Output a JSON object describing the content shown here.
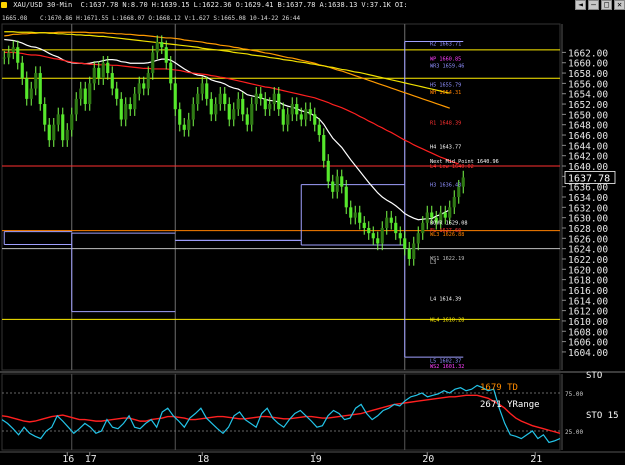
{
  "header": {
    "symbol_info": "XAU/USD 30-Min",
    "stats": [
      "C:1637.78",
      "N:8.70",
      "H:1639.15",
      "L:1622.36",
      "O:1629.41",
      "B:1637.78",
      "A:1638.13",
      "V:37.1K",
      "OI:"
    ],
    "row2": "1665.08",
    "row3": "C:1670.86 H:1671.55 L:1668.07 O:1668.12 V:1.627 S:1665.08 10-14-22 26:44",
    "window_buttons": [
      "◄",
      "—",
      "□",
      "✕"
    ]
  },
  "chart_data": {
    "type": "line",
    "title": "XAU/USD 30-Min",
    "ylim": [
      1600.5,
      1667.5
    ],
    "price_ticks": [
      1604,
      1606,
      1608,
      1610,
      1612,
      1614,
      1616,
      1618,
      1620,
      1622,
      1624,
      1626,
      1628,
      1630,
      1632,
      1634,
      1636,
      1638,
      1640,
      1642,
      1644,
      1646,
      1648,
      1650,
      1652,
      1654,
      1656,
      1658,
      1660,
      1662
    ],
    "last_price": "1637.78",
    "last_price_value": 1637.78,
    "x_labels": [
      {
        "label": "16",
        "bar": 14
      },
      {
        "label": "17",
        "bar": 19
      },
      {
        "label": "18",
        "bar": 44
      },
      {
        "label": "19",
        "bar": 69
      },
      {
        "label": "20",
        "bar": 94
      },
      {
        "label": "21",
        "bar": 118
      }
    ],
    "bar_count": 124,
    "day_separators": [
      15,
      38,
      89
    ],
    "candles": [
      1661,
      1662,
      1663,
      1660,
      1657,
      1653,
      1655,
      1658,
      1652,
      1648,
      1645,
      1648,
      1650,
      1645,
      1647,
      1650,
      1653,
      1655,
      1652,
      1656,
      1659,
      1657,
      1660,
      1658,
      1655,
      1653,
      1649,
      1652,
      1651,
      1654,
      1656,
      1655,
      1658,
      1662,
      1664,
      1663,
      1660,
      1656,
      1651,
      1648,
      1647,
      1649,
      1652,
      1654,
      1656,
      1653,
      1650,
      1652,
      1654,
      1652,
      1649,
      1651,
      1653,
      1650,
      1648,
      1652,
      1654,
      1653,
      1651,
      1652,
      1654,
      1651,
      1648,
      1650,
      1652,
      1650,
      1649,
      1651,
      1650,
      1648,
      1646,
      1641,
      1637,
      1635,
      1638,
      1636,
      1632,
      1630,
      1631,
      1629,
      1628,
      1627,
      1626,
      1625,
      1628,
      1630,
      1629,
      1627,
      1626,
      1624,
      1622,
      1625,
      1627,
      1629,
      1631,
      1630,
      1629,
      1631,
      1630,
      1632,
      1634,
      1636,
      1637.78
    ],
    "series": [
      {
        "values": [
          1664.5,
          1664.4,
          1664.3,
          1664.1,
          1663.8,
          1663.4,
          1663.1,
          1663,
          1662.7,
          1662.3,
          1661.8,
          1661.4,
          1661.1,
          1660.6,
          1660.2,
          1660,
          1659.9,
          1659.9,
          1659.8,
          1659.9,
          1660.1,
          1660.2,
          1660.4,
          1660.6,
          1660.6,
          1660.5,
          1660.2,
          1660.1,
          1659.9,
          1659.9,
          1659.9,
          1659.9,
          1660,
          1660.2,
          1660.5,
          1660.7,
          1660.7,
          1660.5,
          1660,
          1659.4,
          1658.8,
          1658.3,
          1657.9,
          1657.6,
          1657.5,
          1657.2,
          1656.7,
          1656.4,
          1656.2,
          1655.9,
          1655.4,
          1655.1,
          1654.9,
          1654.4,
          1653.8,
          1653.6,
          1653.4,
          1653.2,
          1652.9,
          1652.7,
          1652.6,
          1652.4,
          1651.9,
          1651.6,
          1651.4,
          1651.1,
          1650.7,
          1650.5,
          1650.2,
          1649.7,
          1649.1,
          1648.1,
          1646.7,
          1645.4,
          1644.5,
          1643.6,
          1642.4,
          1641.2,
          1640.1,
          1639,
          1637.9,
          1636.8,
          1635.8,
          1634.8,
          1634,
          1633.4,
          1632.9,
          1632.3,
          1631.6,
          1630.8,
          1630.3,
          1629.9,
          1629.6,
          1629.7,
          1629.8,
          1629.8,
          1630.3,
          1630.6,
          1631.1,
          1631.5
        ]
      },
      {
        "values": [
          1662,
          1662,
          1662,
          1661.9,
          1661.8,
          1661.6,
          1661.5,
          1661.5,
          1661.4,
          1661.2,
          1661,
          1660.8,
          1660.7,
          1660.5,
          1660.3,
          1660.1,
          1660,
          1659.9,
          1659.8,
          1659.7,
          1659.7,
          1659.6,
          1659.6,
          1659.6,
          1659.5,
          1659.5,
          1659.4,
          1659.3,
          1659.2,
          1659.1,
          1659,
          1658.9,
          1658.9,
          1658.8,
          1658.8,
          1658.8,
          1658.8,
          1658.7,
          1658.6,
          1658.5,
          1658.3,
          1658.1,
          1658,
          1657.9,
          1657.8,
          1657.7,
          1657.5,
          1657.4,
          1657.2,
          1657.1,
          1656.9,
          1656.7,
          1656.5,
          1656.3,
          1656.1,
          1655.9,
          1655.7,
          1655.5,
          1655.3,
          1655.2,
          1655,
          1654.8,
          1654.6,
          1654.4,
          1654.2,
          1654,
          1653.8,
          1653.6,
          1653.4,
          1653.2,
          1652.9,
          1652.6,
          1652.3,
          1651.9,
          1651.6,
          1651.3,
          1650.9,
          1650.5,
          1650.1,
          1649.6,
          1649.2,
          1648.7,
          1648.3,
          1647.8,
          1647.4,
          1646.9,
          1646.5,
          1646,
          1645.5,
          1645,
          1644.6,
          1644.1,
          1643.7,
          1643.3,
          1642.9,
          1642.5,
          1642.1,
          1641.7,
          1641.4,
          1641,
          1640.7,
          1640.4
        ]
      },
      {
        "values": [
          1665.2,
          1665.3,
          1665.5,
          1665.5,
          1665.6,
          1665.6,
          1665.7,
          1665.7,
          1665.8,
          1665.8,
          1665.8,
          1665.8,
          1665.9,
          1665.9,
          1665.9,
          1665.9,
          1665.9,
          1665.9,
          1665.9,
          1665.8,
          1665.8,
          1665.8,
          1665.8,
          1665.7,
          1665.7,
          1665.6,
          1665.6,
          1665.5,
          1665.5,
          1665.4,
          1665.3,
          1665.3,
          1665.2,
          1665.1,
          1665,
          1664.9,
          1664.8,
          1664.8,
          1664.7,
          1664.6,
          1664.4,
          1664.3,
          1664.2,
          1664.1,
          1664,
          1663.8,
          1663.7,
          1663.6,
          1663.4,
          1663.3,
          1663.2,
          1663,
          1662.9,
          1662.7,
          1662.6,
          1662.4,
          1662.3,
          1662.1,
          1661.9,
          1661.8,
          1661.6,
          1661.4,
          1661.2,
          1661,
          1660.9,
          1660.7,
          1660.5,
          1660.3,
          1660.1,
          1659.9,
          1659.6,
          1659.4,
          1659.2,
          1658.9,
          1658.6,
          1658.4,
          1658.1,
          1657.8,
          1657.5,
          1657.2,
          1656.9,
          1656.6,
          1656.3,
          1656,
          1655.7,
          1655.4,
          1655.1,
          1654.8,
          1654.5,
          1654.2,
          1653.9,
          1653.6,
          1653.3,
          1653,
          1652.7,
          1652.4,
          1652.1,
          1651.8,
          1651.5,
          1651.2
        ]
      },
      {
        "values": [
          1666,
          1666,
          1666,
          1665.9,
          1665.9,
          1665.9,
          1665.9,
          1665.8,
          1665.8,
          1665.8,
          1665.7,
          1665.7,
          1665.6,
          1665.6,
          1665.5,
          1665.5,
          1665.4,
          1665.4,
          1665.3,
          1665.3,
          1665.2,
          1665.1,
          1665.1,
          1665,
          1664.9,
          1664.8,
          1664.7,
          1664.6,
          1664.5,
          1664.4,
          1664.3,
          1664.2,
          1664.1,
          1664,
          1663.9,
          1663.8,
          1663.7,
          1663.6,
          1663.5,
          1663.4,
          1663.3,
          1663.2,
          1663.1,
          1663,
          1662.8,
          1662.7,
          1662.6,
          1662.5,
          1662.4,
          1662.3,
          1662.2,
          1662,
          1661.9,
          1661.8,
          1661.7,
          1661.5,
          1661.4,
          1661.3,
          1661.2,
          1661,
          1660.9,
          1660.8,
          1660.6,
          1660.5,
          1660.4,
          1660.2,
          1660.1,
          1660,
          1659.8,
          1659.7,
          1659.5,
          1659.4,
          1659.2,
          1659.1,
          1658.9,
          1658.7,
          1658.6,
          1658.4,
          1658.2,
          1658.1,
          1657.9,
          1657.7,
          1657.5,
          1657.3,
          1657.1,
          1656.9,
          1656.7,
          1656.5,
          1656.3,
          1656.1,
          1655.9,
          1655.7,
          1655.5,
          1655.3,
          1655.1,
          1654.9,
          1654.7,
          1654.5,
          1654.3,
          1654.1
        ]
      }
    ],
    "horizontal_lines": [
      {
        "label": "",
        "value": 1657.0,
        "color": "#ffee00"
      },
      {
        "label": "",
        "value": 1662.5,
        "color": "#ffee00"
      },
      {
        "label": "",
        "value": 1640.0,
        "color": "#ff3030"
      },
      {
        "label": "",
        "value": 1627.5,
        "color": "#ff8000"
      },
      {
        "label": "",
        "value": 1624.0,
        "color": "#c0c0c0"
      },
      {
        "label": "",
        "value": 1610.3,
        "color": "#ffee00"
      }
    ],
    "steps": [
      {
        "x0": 0,
        "x1": 15,
        "hi": 1627.3,
        "lo": 1624.8
      },
      {
        "x0": 15,
        "x1": 38,
        "hi": 1627.0,
        "lo": 1611.8
      },
      {
        "x0": 38,
        "x1": 66,
        "hi": 1625.6,
        "lo": 1625.6
      },
      {
        "x0": 66,
        "x1": 89,
        "hi": 1636.4,
        "lo": 1624.7
      },
      {
        "x0": 89,
        "x1": 102,
        "hi": 1664.1,
        "lo": 1603.0
      }
    ],
    "pivot_labels": [
      {
        "text": "R2 1663.71",
        "value": 1663.71,
        "color": "#9090ff"
      },
      {
        "text": "WP 1660.85",
        "value": 1660.85,
        "color": "#ff40ff"
      },
      {
        "text": "WR3 1659.46",
        "value": 1659.46,
        "color": "#9090ff"
      },
      {
        "text": "H5 1655.79",
        "value": 1655.79,
        "color": "#9090ff"
      },
      {
        "text": "WH 1654.31",
        "value": 1654.31,
        "color": "#ff8000"
      },
      {
        "text": "R1 1648.39",
        "value": 1648.39,
        "color": "#ff3030"
      },
      {
        "text": "H4 1643.77",
        "value": 1643.77,
        "color": "#ffffff"
      },
      {
        "text": "Next Mid Point 1640.96",
        "value": 1640.96,
        "color": "#ffffff"
      },
      {
        "text": "L4 Low 1640.02",
        "value": 1640.02,
        "color": "#ff3030"
      },
      {
        "text": "H3 1636.43",
        "value": 1636.43,
        "color": "#9090ff"
      },
      {
        "text": "BOVR 1629.08",
        "value": 1629.08,
        "color": "#ffffff"
      },
      {
        "text": "WL3 1626.88",
        "value": 1626.88,
        "color": "#ff8000"
      },
      {
        "text": "FL 1627.60",
        "value": 1627.6,
        "color": "#ff3030"
      },
      {
        "text": "WS1 1622.19",
        "value": 1622.19,
        "color": "#c0c0c0"
      },
      {
        "text": "L3",
        "value": 1621.4,
        "color": "#c0c0c0"
      },
      {
        "text": "L4 1614.39",
        "value": 1614.39,
        "color": "#ffffff"
      },
      {
        "text": "WL4 1610.28",
        "value": 1610.28,
        "color": "#ffee00"
      },
      {
        "text": "L5 1602.37",
        "value": 1602.37,
        "color": "#9090ff"
      },
      {
        "text": "WS2 1601.32",
        "value": 1601.32,
        "color": "#ff40ff"
      }
    ],
    "indicator": {
      "title": "STO",
      "labels": [
        "1679 TD",
        "2671 YRange"
      ],
      "right_labels": [
        "STO",
        "15",
        "75.00"
      ],
      "levels": [
        25,
        75
      ],
      "fast": [
        40,
        35,
        28,
        20,
        30,
        22,
        18,
        15,
        25,
        30,
        45,
        38,
        30,
        22,
        28,
        35,
        30,
        22,
        25,
        40,
        30,
        28,
        35,
        45,
        30,
        28,
        35,
        40,
        30,
        50,
        55,
        45,
        38,
        30,
        42,
        48,
        55,
        42,
        35,
        28,
        22,
        30,
        45,
        50,
        40,
        35,
        30,
        48,
        55,
        42,
        35,
        30,
        40,
        48,
        52,
        45,
        38,
        30,
        32,
        45,
        52,
        48,
        40,
        42,
        55,
        60,
        48,
        40,
        45,
        52,
        55,
        60,
        58,
        65,
        70,
        72,
        75,
        70,
        72,
        74,
        78,
        75,
        80,
        82,
        78,
        80,
        85,
        82,
        78,
        80,
        55,
        35,
        20,
        18,
        15,
        20,
        25,
        15,
        20,
        10,
        12,
        15
      ],
      "slow": [
        45,
        44,
        42,
        40,
        38,
        37,
        38,
        40,
        42,
        44,
        45,
        46,
        44,
        42,
        40,
        40,
        39,
        38,
        38,
        39,
        40,
        41,
        42,
        42,
        40,
        38,
        38,
        40,
        41,
        42,
        44,
        44,
        43,
        42,
        40,
        40,
        41,
        42,
        43,
        44,
        44,
        43,
        42,
        41,
        41,
        42,
        43,
        44,
        44,
        43,
        42,
        41,
        41,
        42,
        43,
        44,
        44,
        43,
        42,
        42,
        43,
        44,
        45,
        46,
        47,
        48,
        50,
        52,
        54,
        56,
        58,
        60,
        61,
        62,
        63,
        64,
        65,
        66,
        67,
        68,
        69,
        70,
        70,
        71,
        72,
        72,
        72,
        70,
        68,
        64,
        60,
        55,
        48,
        42,
        38,
        35,
        32,
        30,
        28,
        26,
        24,
        22
      ]
    }
  }
}
